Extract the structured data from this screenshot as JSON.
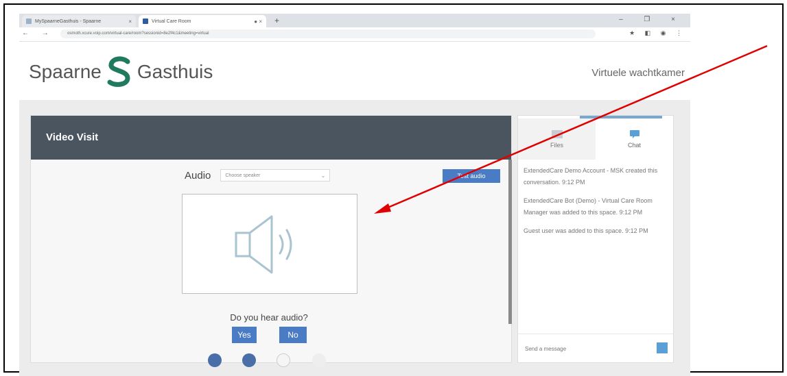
{
  "browser": {
    "tabs": [
      {
        "title": "MySpaarneGasthuis - Spaarne"
      },
      {
        "title": "Virtual Care Room"
      }
    ],
    "new_tab": "+",
    "url": "osmoth.xcure.voip.com/virtual-care/room?sessionid=8e2f4c1&meeting=virtual"
  },
  "site": {
    "logo_left": "Spaarne",
    "logo_right": "Gasthuis",
    "waiting_room": "Virtuele wachtkamer"
  },
  "visit": {
    "title": "Video Visit",
    "audio_label": "Audio",
    "speaker_placeholder": "Choose speaker",
    "test_button": "Test audio",
    "question": "Do you hear audio?",
    "yes": "Yes",
    "no": "No"
  },
  "panel": {
    "tabs": {
      "files": "Files",
      "chat": "Chat"
    },
    "messages": [
      "ExtendedCare Demo Account - MSK created this conversation. 9:12 PM",
      "ExtendedCare Bot (Demo) - Virtual Care Room Manager was added to this space. 9:12 PM",
      "Guest user was added to this space. 9:12 PM"
    ],
    "compose_placeholder": "Send a message"
  },
  "colors": {
    "header_dark": "#4a5560",
    "button_blue": "#4a7cc6",
    "logo_green": "#1f7a5e",
    "arrow": "#e00000"
  }
}
